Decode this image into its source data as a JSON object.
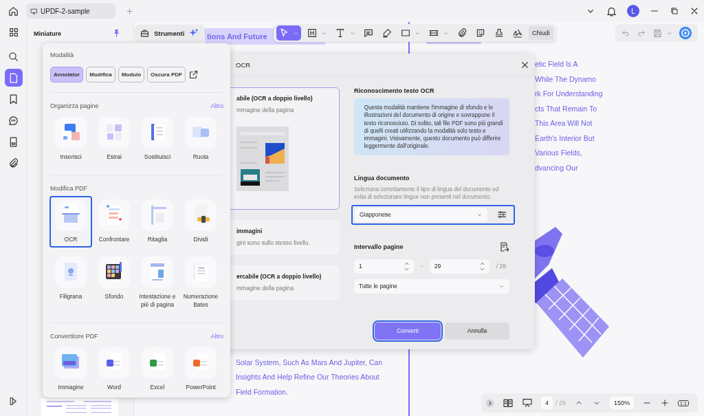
{
  "title_bar": {
    "tab_title": "UPDF-2-sample",
    "avatar": "L"
  },
  "sidebar": {
    "items": [
      {
        "kind": "search",
        "selected": false
      },
      {
        "kind": "pages",
        "selected": true
      },
      {
        "kind": "bookmark",
        "selected": false
      },
      {
        "kind": "comment",
        "selected": false
      },
      {
        "kind": "form",
        "selected": false
      },
      {
        "kind": "attachment",
        "selected": false
      }
    ]
  },
  "thumbnails": {
    "title": "Miniature"
  },
  "tools_button": {
    "label": "Strumenti"
  },
  "toolbar": {
    "tools": [
      {
        "kind": "select",
        "selected": true,
        "menu": true
      },
      {
        "kind": "heading",
        "selected": false,
        "menu": true
      },
      {
        "kind": "text",
        "selected": false,
        "menu": true
      },
      {
        "kind": "note",
        "selected": false,
        "menu": false
      },
      {
        "kind": "highlight",
        "selected": false,
        "menu": false
      },
      {
        "kind": "shape",
        "selected": false,
        "menu": true
      },
      {
        "kind": "measure",
        "selected": false,
        "menu": true
      },
      {
        "kind": "attach",
        "selected": false,
        "menu": false
      },
      {
        "kind": "sticker",
        "selected": false,
        "menu": false
      },
      {
        "kind": "stamp",
        "selected": false,
        "menu": false
      },
      {
        "kind": "signature",
        "selected": false,
        "menu": false
      }
    ],
    "close": "Chiudi"
  },
  "document": {
    "heading": "tions And Future",
    "right_lines": [
      "etic Field Is A",
      "While The Dynamo",
      "rk For Understanding",
      "cts That Remain To",
      "This Area Will Not",
      "Earth's Interior But",
      "Various Fields,",
      "dvancing Our"
    ],
    "bottom_lines": [
      "Solar System, Such As Mars And Jupiter, Can",
      "Insights And Help Refine Our Theories About",
      "Field Formation."
    ]
  },
  "tools_panel": {
    "modes_title": "Modalità",
    "modes": [
      {
        "label": "Annotator",
        "selected": true
      },
      {
        "label": "Modifica",
        "selected": false
      },
      {
        "label": "Modulo",
        "selected": false
      },
      {
        "label": "Oscura PDF",
        "selected": false
      }
    ],
    "sections": [
      {
        "title": "Organizza pagine",
        "more": "Altro",
        "items": [
          {
            "label": "Inserisci",
            "kind": "insert",
            "selected": false
          },
          {
            "label": "Estrai",
            "kind": "extract",
            "selected": false
          },
          {
            "label": "Sostituisci",
            "kind": "replace",
            "selected": false
          },
          {
            "label": "Ruota",
            "kind": "rotate",
            "selected": false
          }
        ]
      },
      {
        "title": "Modifica PDF",
        "items": [
          {
            "label": "OCR",
            "kind": "ocr",
            "selected": true
          },
          {
            "label": "Confrontare",
            "kind": "compare",
            "selected": false
          },
          {
            "label": "Ritaglia",
            "kind": "crop",
            "selected": false
          },
          {
            "label": "Dividi",
            "kind": "split",
            "selected": false
          },
          {
            "label": "Filigrana",
            "kind": "watermark",
            "selected": false
          },
          {
            "label": "Sfondo",
            "kind": "background",
            "selected": false
          },
          {
            "label": "Intestazione e piè di pagina",
            "kind": "header",
            "selected": false
          },
          {
            "label": "Numerazione Bates",
            "kind": "bates",
            "selected": false
          }
        ]
      },
      {
        "title": "Convertitore PDF",
        "more": "Altro",
        "items": [
          {
            "label": "Immagine",
            "kind": "image",
            "selected": false
          },
          {
            "label": "Word",
            "kind": "word",
            "selected": false
          },
          {
            "label": "Excel",
            "kind": "excel",
            "selected": false
          },
          {
            "label": "PowerPoint",
            "kind": "powerpoint",
            "selected": false
          }
        ]
      }
    ]
  },
  "ocr_dialog": {
    "title": "OCR",
    "options": [
      {
        "title": "abile (OCR a doppio livello)",
        "description": "mmagine della pagina",
        "selected": true
      },
      {
        "title": "immagini",
        "description": "gini sono sullo stesso livello.",
        "selected": false
      },
      {
        "title": "ercabile (OCR a doppio livello)",
        "description": "mmagine della pagina",
        "selected": false
      }
    ],
    "section_title": "Riconoscimento testo OCR",
    "info": "Questa modalità mantiene l'immagine di sfondo e le illustrazioni del documento di origine e sovrappone il testo riconosciuto. Di solito, tali file PDF sono più grandi di quelli creati utilizzando la modalità solo testo e immagini. Visivamente, questo documento può differire leggermente dall'originale.",
    "language_title": "Lingua documento",
    "language_hint": "Seleziona correttamente il tipo di lingua del documento ed evita di selezionare lingue non presenti nel documento.",
    "language": "Giapponese",
    "range_title": "Intervallo pagine",
    "from": "1",
    "separator": "-",
    "to": "29",
    "total": "/ 29",
    "scope": "Tutte le pagine",
    "convert": "Converti",
    "cancel": "Annulla"
  },
  "bottom_bar": {
    "page": "4",
    "total": "/ 29",
    "zoom": "150%",
    "actual_size": "1:1"
  }
}
